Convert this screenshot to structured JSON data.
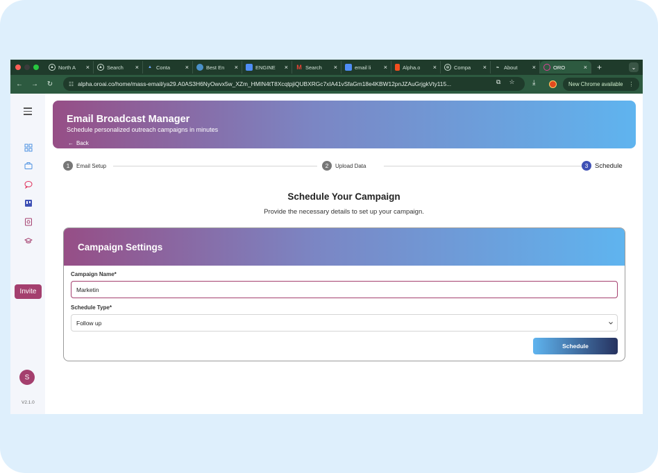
{
  "browser": {
    "tabs": [
      {
        "label": "North A",
        "icon": "mountain-icon"
      },
      {
        "label": "Search",
        "icon": "mountain-icon"
      },
      {
        "label": "Conta",
        "icon": "triangle-icon"
      },
      {
        "label": "Best En",
        "icon": "globe-icon"
      },
      {
        "label": "ENGINE",
        "icon": "doc-icon"
      },
      {
        "label": "Search",
        "icon": "gmail-icon"
      },
      {
        "label": "email li",
        "icon": "doc-icon"
      },
      {
        "label": "Alpha.o",
        "icon": "figma-icon"
      },
      {
        "label": "Compa",
        "icon": "openai-icon"
      },
      {
        "label": "About",
        "icon": "leaf-icon"
      },
      {
        "label": "ORO",
        "icon": "oro-icon",
        "active": true
      }
    ],
    "url": "alpha.oroai.co/home/mass-email/ya29.A0AS3H6NyOwvx5w_XZm_HMIN4tT8XcqtpjiQUBXRGc7xIA41vSfaGm18e4KBW12pnJZAuGrjgkVty115...",
    "new_chrome": "New Chrome available",
    "menu_dots": "⋮"
  },
  "sidebar": {
    "invite": "Invite",
    "avatar": "S",
    "version": "V2.1.0"
  },
  "header": {
    "title": "Email Broadcast Manager",
    "subtitle": "Schedule personalized outreach campaigns in minutes",
    "back": "Back"
  },
  "steps": [
    {
      "num": "1",
      "label": "Email Setup"
    },
    {
      "num": "2",
      "label": "Upload Data"
    },
    {
      "num": "3",
      "label": "Schedule",
      "active": true
    }
  ],
  "page": {
    "title": "Schedule Your Campaign",
    "subtitle": "Provide the necessary details to set up your campaign."
  },
  "card": {
    "title": "Campaign Settings",
    "name_label": "Campaign Name*",
    "name_value": "Marketin",
    "type_label": "Schedule Type*",
    "type_value": "Follow up",
    "button": "Schedule"
  },
  "colors": {
    "brand": "#a43f6e",
    "step_active": "#3f51b5",
    "chrome_bg": "#1f3b2b"
  }
}
